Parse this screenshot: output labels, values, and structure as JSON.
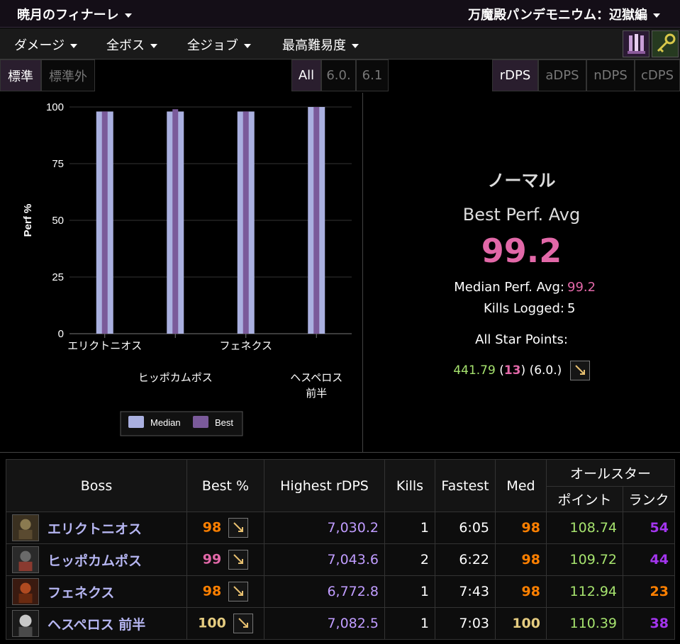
{
  "topbar": {
    "left_title": "暁月のフィナーレ",
    "right_title": "万魔殿パンデモニウム：辺獄編"
  },
  "menu": {
    "items": [
      "ダメージ",
      "全ボス",
      "全ジョブ",
      "最高難易度"
    ]
  },
  "filters": {
    "standard": [
      "標準",
      "標準外"
    ],
    "patches": [
      "All",
      "6.0.",
      "6.1"
    ],
    "metrics": [
      "rDPS",
      "aDPS",
      "nDPS",
      "cDPS"
    ]
  },
  "chart_data": {
    "type": "bar",
    "categories": [
      "エリクトニオス",
      "ヒッポカムポス",
      "フェネクス",
      "ヘスペロス 前半"
    ],
    "category_lines": [
      [
        "エリクトニオス"
      ],
      [
        "ヒッポカムポス"
      ],
      [
        "フェネクス"
      ],
      [
        "ヘスペロス",
        "前半"
      ]
    ],
    "series": [
      {
        "name": "Median",
        "values": [
          98,
          98,
          98,
          100
        ],
        "color": "#aab0e0"
      },
      {
        "name": "Best",
        "values": [
          98,
          99,
          98,
          100
        ],
        "color": "#7a5a9a"
      }
    ],
    "ylabel": "Perf %",
    "yticks": [
      "100",
      "75",
      "50",
      "25",
      "0"
    ],
    "ylim": [
      0,
      100
    ],
    "legend": "bottom"
  },
  "summary": {
    "difficulty": "ノーマル",
    "best_label": "Best Perf. Avg",
    "best_value": "99.2",
    "median_label": "Median Perf. Avg:",
    "median_value": "99.2",
    "kills_label": "Kills Logged:",
    "kills_value": "5",
    "allstar_label": "All Star Points:",
    "allstar_points": "441.79",
    "allstar_rank": "13",
    "allstar_patch": "(6.0.)"
  },
  "table": {
    "headers": {
      "boss": "Boss",
      "best": "Best %",
      "highest": "Highest rDPS",
      "kills": "Kills",
      "fastest": "Fastest",
      "med": "Med",
      "allstar": "オールスター",
      "points": "ポイント",
      "rank": "ランク"
    },
    "rows": [
      {
        "boss": "エリクトニオス",
        "best": "98",
        "highest": "7,030.2",
        "kills": "1",
        "fastest": "6:05",
        "med": "98",
        "points": "108.74",
        "rank": "54"
      },
      {
        "boss": "ヒッポカムポス",
        "best": "99",
        "highest": "7,043.6",
        "kills": "2",
        "fastest": "6:22",
        "med": "98",
        "points": "109.72",
        "rank": "44"
      },
      {
        "boss": "フェネクス",
        "best": "98",
        "highest": "6,772.8",
        "kills": "1",
        "fastest": "7:43",
        "med": "98",
        "points": "112.94",
        "rank": "23"
      },
      {
        "boss": "ヘスペロス 前半",
        "best": "100",
        "highest": "7,082.5",
        "kills": "1",
        "fastest": "7:03",
        "med": "100",
        "points": "110.39",
        "rank": "38"
      }
    ]
  }
}
